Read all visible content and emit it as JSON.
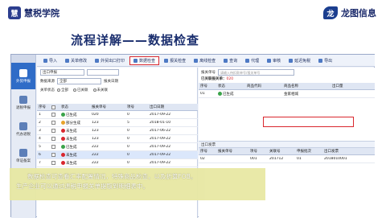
{
  "header": {
    "left_brand_mark": "慧",
    "left_brand": "慧税学院",
    "right_brand_mark": "龙",
    "right_brand": "龙图信息"
  },
  "heading": "流程详解——数据检查",
  "sidebar": {
    "items": [
      {
        "label": "外贸申报",
        "active": true
      },
      {
        "label": "退税申报",
        "active": false
      },
      {
        "label": "代办退税",
        "active": false
      },
      {
        "label": "单证备案",
        "active": false
      }
    ]
  },
  "toolbar": {
    "buttons": [
      "导入",
      "关单修改",
      "外贸出口打印",
      "数据检查",
      "报关检查",
      "离线检查",
      "查询",
      "代理",
      "审核",
      "延迟免税",
      "导出",
      "导出"
    ],
    "highlighted": "数据检查"
  },
  "filters": {
    "export_type_label": "出口申报",
    "data_label": "数据来源",
    "data_value": "全部",
    "date_label": "报关日期",
    "relation_label": "关单状态",
    "radio_options": [
      "全部",
      "已关联",
      "未关联"
    ]
  },
  "left_table": {
    "headers": [
      "序号",
      "",
      "状态",
      "报关单号",
      "项号",
      "出口日期"
    ],
    "rows": [
      {
        "no": "1",
        "status": "已生成",
        "status_color": "#3aa34a",
        "bill": "020",
        "item": "0",
        "date": "2017-09-22"
      },
      {
        "no": "2",
        "status": "部分生成",
        "status_color": "#e8a32b",
        "bill": "123",
        "item": "5",
        "date": "2018-01-10"
      },
      {
        "no": "3",
        "status": "未生成",
        "status_color": "#d9272e",
        "bill": "123",
        "item": "0",
        "date": "2017-06-22"
      },
      {
        "no": "4",
        "status": "未生成",
        "status_color": "#d9272e",
        "bill": "123",
        "item": "0",
        "date": "2017-09-22"
      },
      {
        "no": "5",
        "status": "已生成",
        "status_color": "#3aa34a",
        "bill": "222",
        "item": "0",
        "date": "2017-09-22"
      },
      {
        "no": "6",
        "status": "未生成",
        "status_color": "#d9272e",
        "bill": "222",
        "item": "0",
        "date": "2017-09-22"
      },
      {
        "no": "7",
        "status": "未生成",
        "status_color": "#d9272e",
        "bill": "222",
        "item": "0",
        "date": "2017-09-22"
      }
    ]
  },
  "right_panel": {
    "search_label": "报关单号",
    "search_placeholder": "请输入待扣款单号/报关单号",
    "status_prefix": "已关联报关单：",
    "status_count": "020",
    "top_headers": [
      "序号",
      "状态",
      "商品代码",
      "商品名称",
      "出口量"
    ],
    "top_rows": [
      {
        "no": "01",
        "status": "已生成",
        "code": "",
        "name": "金家相城",
        "qty": ""
      }
    ],
    "sub_header": "出口发票",
    "bottom_headers": [
      "序号",
      "报关单号",
      "项号",
      "关联号",
      "申报批次",
      "出口发票"
    ],
    "bottom_rows": [
      {
        "no": "02",
        "bill": "",
        "item": "001",
        "rel": "201712",
        "batch": "01",
        "invoice": "2018010001"
      }
    ]
  },
  "caption": {
    "line1": "数据检查可查看汇率配置情况，特殊商品检查，以及折算FOB。",
    "line2": "生产企业可以通过退税申报关单提取到明细表中。"
  },
  "colors": {
    "accent": "#2f6cc7",
    "highlight": "#d9272e",
    "caption_bg": "#e8e8a4"
  }
}
